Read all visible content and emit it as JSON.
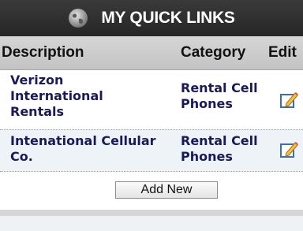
{
  "header": {
    "title": "MY QUICK LINKS",
    "icon": "globe-icon"
  },
  "columns": {
    "description": "Description",
    "category": "Category",
    "edit": "Edit"
  },
  "rows": [
    {
      "description_lines": [
        "Verizon",
        "International",
        "Rentals"
      ],
      "category_lines": [
        "Rental Cell",
        "Phones"
      ],
      "edit_icon": "edit-pencil-icon"
    },
    {
      "description_lines": [
        "Intenational Cellular",
        "Co."
      ],
      "category_lines": [
        "Rental Cell",
        "Phones"
      ],
      "edit_icon": "edit-pencil-icon"
    }
  ],
  "add_button": "Add New",
  "colors": {
    "header_bg": "#2b2b2b",
    "column_header_bg": "#cfcfcf",
    "text": "#1a1a5a",
    "row_alt_bg": "#eef3f8"
  }
}
